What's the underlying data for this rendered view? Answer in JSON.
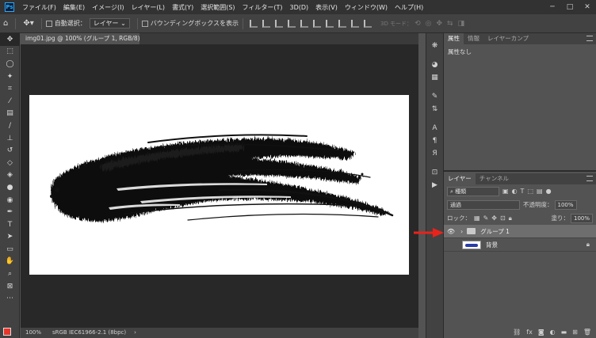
{
  "menubar": {
    "logo": "Ps",
    "items": [
      "ファイル(F)",
      "編集(E)",
      "イメージ(I)",
      "レイヤー(L)",
      "書式(Y)",
      "選択範囲(S)",
      "フィルター(T)",
      "3D(D)",
      "表示(V)",
      "ウィンドウ(W)",
      "ヘルプ(H)"
    ],
    "controls": [
      "─",
      "□",
      "✕"
    ]
  },
  "options": {
    "auto_select_label": "自動選択：",
    "auto_select_value": "レイヤー",
    "bounding_box_label": "バウンディングボックスを表示",
    "mode_3d_label": "3D モード："
  },
  "document": {
    "tab_title": "img01.jpg @ 100% (グループ 1, RGB/8) *",
    "tab_close": "×",
    "status_zoom": "100%",
    "status_profile": "sRGB IEC61966-2.1 (8bpc)",
    "status_arrow": "›"
  },
  "properties": {
    "tabs": [
      "属性",
      "情報",
      "レイヤーカンプ"
    ],
    "empty_text": "属性なし"
  },
  "layers": {
    "tabs": [
      "レイヤー",
      "チャンネル"
    ],
    "filter_kind": "種類",
    "blend_mode": "通過",
    "opacity_label": "不透明度：",
    "opacity_value": "100%",
    "lock_label": "ロック：",
    "fill_label": "塗り：",
    "fill_value": "100%",
    "items": [
      {
        "name": "グループ 1",
        "type": "group",
        "visible": true,
        "selected": true
      },
      {
        "name": "背景",
        "type": "pixel",
        "visible": false,
        "selected": false,
        "locked": true
      }
    ],
    "footer_icons": [
      "link-icon",
      "fx-icon",
      "mask-icon",
      "adjustment-icon",
      "folder-icon",
      "new-layer-icon",
      "trash-icon"
    ]
  },
  "colors": {
    "foreground": "#e8352a",
    "background": "#ffffff",
    "annotation_arrow": "#e8231c"
  }
}
